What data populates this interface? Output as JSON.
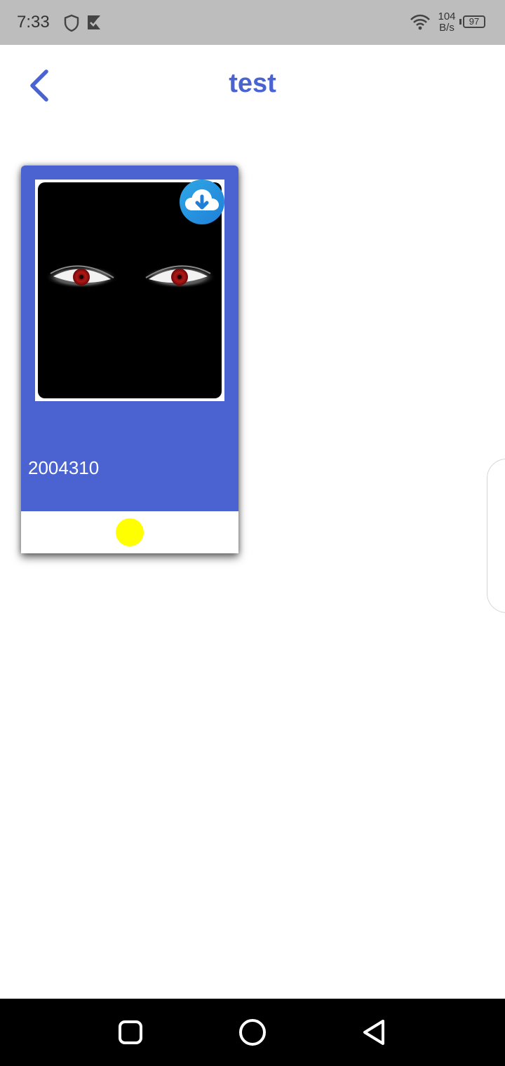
{
  "status_bar": {
    "time": "7:33",
    "net_speed_value": "104",
    "net_speed_unit": "B/s",
    "battery": "97",
    "icons": [
      "shield-icon",
      "play-store-icon",
      "wifi-icon",
      "battery-icon"
    ]
  },
  "header": {
    "title": "test",
    "back_icon": "chevron-left-icon"
  },
  "card": {
    "id_text": "2004310",
    "download_icon": "cloud-download-icon",
    "status_color": "#ffff00"
  },
  "colors": {
    "primary": "#4a63d0",
    "status_bar": "#bdbdbd",
    "nav_bar": "#000000"
  },
  "nav_bar": {
    "buttons": [
      "recents-button",
      "home-button",
      "back-button"
    ]
  }
}
